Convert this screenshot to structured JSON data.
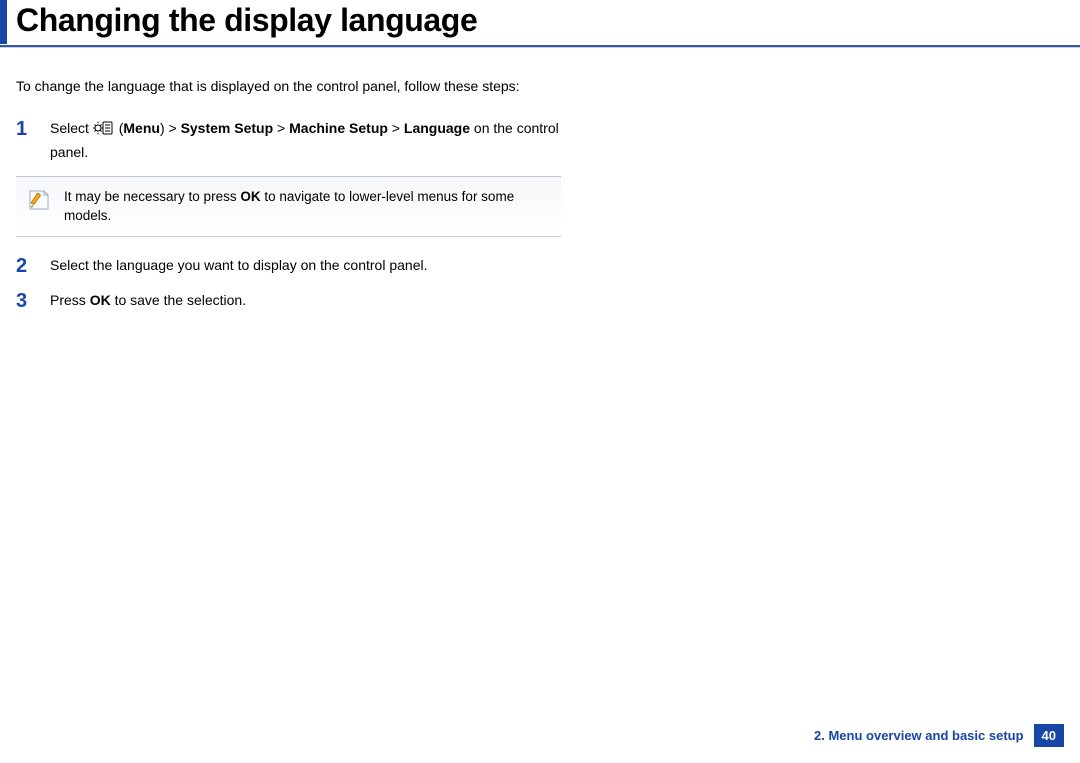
{
  "title": "Changing the display language",
  "intro": "To change the language that is displayed on the control panel, follow these steps:",
  "steps": {
    "s1": {
      "num": "1",
      "pre": "Select ",
      "menu_open": "(",
      "menu_label": "Menu",
      "menu_close": ") > ",
      "b1": "System Setup",
      "sep1": " > ",
      "b2": "Machine Setup",
      "sep2": " > ",
      "b3": "Language",
      "post": " on the control panel."
    },
    "s2": {
      "num": "2",
      "text": "Select the language you want to display on the control panel."
    },
    "s3": {
      "num": "3",
      "pre": "Press ",
      "b1": "OK",
      "post": " to save the selection."
    }
  },
  "note": {
    "pre": "It may be necessary to press ",
    "b1": "OK",
    "post": " to navigate to lower-level menus for some models."
  },
  "footer": {
    "chapter": "2.  Menu overview and basic setup",
    "page": "40"
  }
}
